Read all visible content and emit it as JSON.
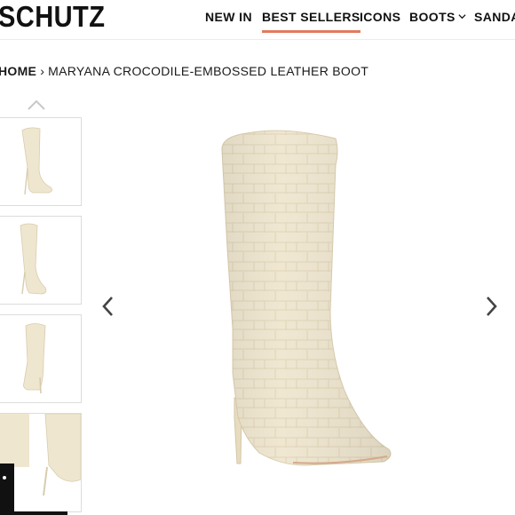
{
  "header": {
    "logo": "SCHUTZ",
    "nav": [
      {
        "label": "NEW IN"
      },
      {
        "label": "BEST SELLERS",
        "active": true
      },
      {
        "label": "ICONS"
      },
      {
        "label": "BOOTS",
        "has_dropdown": true
      },
      {
        "label": "SANDAL"
      }
    ]
  },
  "breadcrumb": {
    "home": "HOME",
    "separator": "›",
    "current": "MARYANA CROCODILE-EMBOSSED LEATHER BOOT"
  },
  "gallery": {
    "thumbnail_count": 4,
    "prev_icon": "chevron-up-icon",
    "next_icon": "chevron-down-icon"
  },
  "main_image": {
    "prev_icon": "chevron-left-icon",
    "next_icon": "chevron-right-icon"
  },
  "colors": {
    "accent_underline": "#e37b5f",
    "boot_cream": "#efe6cf",
    "text": "#1a1a1a"
  }
}
